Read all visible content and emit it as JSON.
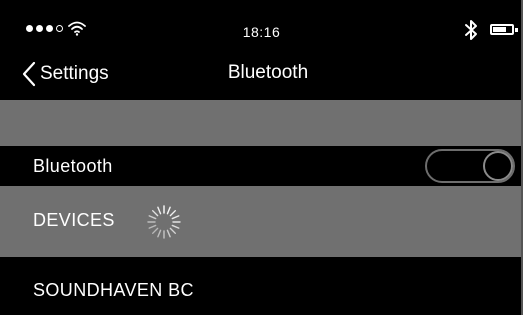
{
  "status_bar": {
    "time": "18:16",
    "signal_icon": "signal-dots-icon",
    "wifi_icon": "wifi-icon",
    "bluetooth_icon": "bluetooth-icon",
    "battery_icon": "battery-icon"
  },
  "nav": {
    "back_label": "Settings",
    "title": "Bluetooth"
  },
  "bluetooth_row": {
    "label": "Bluetooth",
    "toggle_on": false
  },
  "devices": {
    "header": "DEVICES",
    "scanning_indicator": "spinner-icon",
    "items": [
      {
        "name": "SOUNDHAVEN BC"
      }
    ]
  }
}
